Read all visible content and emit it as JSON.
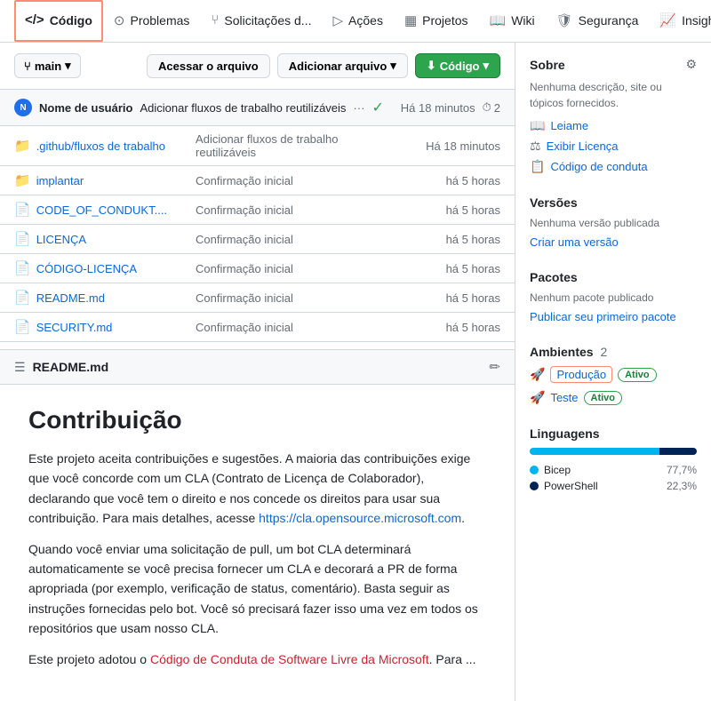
{
  "nav": {
    "tabs": [
      {
        "id": "code",
        "label": "Código",
        "icon": "</>",
        "active": true
      },
      {
        "id": "issues",
        "label": "Problemas",
        "icon": "⊙"
      },
      {
        "id": "prs",
        "label": "Solicitações d...",
        "icon": "⑂"
      },
      {
        "id": "actions",
        "label": "Ações",
        "icon": "▷"
      },
      {
        "id": "projects",
        "label": "Projetos",
        "icon": "▦"
      },
      {
        "id": "wiki",
        "label": "Wiki",
        "icon": "📖"
      },
      {
        "id": "security",
        "label": "Segurança",
        "icon": "🛡"
      },
      {
        "id": "insights",
        "label": "Insights",
        "icon": "📈"
      },
      {
        "id": "more",
        "label": "...",
        "icon": ""
      }
    ]
  },
  "branch_bar": {
    "branch_label": "main",
    "branch_icon": "⑂",
    "chevron": "▾",
    "access_file_btn": "Acessar o arquivo",
    "add_file_btn": "Adicionar arquivo",
    "add_file_chevron": "▾",
    "code_btn": "Código",
    "code_chevron": "▾"
  },
  "commit_row": {
    "username": "Nome de usuário",
    "message": "Adicionar fluxos de trabalho reutilizáveis",
    "dots": "···",
    "status_icon": "✓",
    "time": "Há 18 minutos",
    "clock_icon": "⏱",
    "count": "2"
  },
  "files": [
    {
      "icon": "📁",
      "name": ".github/fluxos de trabalho",
      "commit": "Adicionar fluxos de trabalho reutilizáveis",
      "time": "Há 18 minutos"
    },
    {
      "icon": "📁",
      "name": "implantar",
      "commit": "Confirmação inicial",
      "time": "há 5 horas"
    },
    {
      "icon": "📄",
      "name": "CODE_OF_CONDUKT....",
      "commit": "Confirmação inicial",
      "time": "há 5 horas"
    },
    {
      "icon": "📄",
      "name": "LICENÇA",
      "commit": "Confirmação inicial",
      "time": "há 5 horas"
    },
    {
      "icon": "📄",
      "name": "CÓDIGO-LICENÇA",
      "commit": "Confirmação inicial",
      "time": "há 5 horas"
    },
    {
      "icon": "📄",
      "name": "README.md",
      "commit": "Confirmação inicial",
      "time": "há 5 horas"
    },
    {
      "icon": "📄",
      "name": "SECURITY.md",
      "commit": "Confirmação inicial",
      "time": "há 5 horas"
    }
  ],
  "readme": {
    "title": "README.md",
    "edit_icon": "✏",
    "heading": "Contribuição",
    "p1": "Este projeto aceita contribuições e sugestões. A maioria das contribuições exige que você concorde com um CLA (Contrato de Licença de Colaborador), declarando que você tem o direito e nos concede os direitos para usar sua contribuição. Para mais detalhes, acesse ",
    "p1_link": "https://cla.opensource.microsoft.com",
    "p1_link_text": "https://cla.opensource.microsoft.com",
    "p2": "Quando você enviar uma solicitação de pull, um bot CLA determinará automaticamente se você precisa fornecer um CLA e decorará a PR de forma apropriada (por exemplo, verificação de status, comentário). Basta seguir as instruções fornecidas pelo bot. Você só precisará fazer isso uma vez em todos os repositórios que usam nosso CLA.",
    "p3_prefix": "Este projeto adotou o ",
    "p3_link_text": "Código de Conduta de Software Livre da Microsoft",
    "p3_suffix": ". Para ..."
  },
  "sidebar": {
    "sobre": {
      "title": "Sobre",
      "gear_icon": "⚙",
      "description": "Nenhuma descrição, site ou tópicos fornecidos.",
      "links": [
        {
          "icon": "📖",
          "text": "Leiame"
        },
        {
          "icon": "⚖",
          "text": "Exibir Licença"
        },
        {
          "icon": "📋",
          "text": "Código de conduta"
        }
      ]
    },
    "versoes": {
      "title": "Versões",
      "no_versions": "Nenhuma versão publicada",
      "create_link": "Criar uma versão"
    },
    "pacotes": {
      "title": "Pacotes",
      "no_packages": "Nenhum pacote publicado",
      "publish_link": "Publicar seu primeiro pacote"
    },
    "ambientes": {
      "title": "Ambientes",
      "count": "2",
      "items": [
        {
          "name": "Produção",
          "badge": "Ativo",
          "highlighted": true
        },
        {
          "name": "Teste",
          "badge": "Ativo",
          "highlighted": false
        }
      ]
    },
    "linguagens": {
      "title": "Linguagens",
      "items": [
        {
          "name": "Bicep",
          "pct": "77,7%",
          "color": "#00b4f0",
          "width": 77.7
        },
        {
          "name": "PowerShell",
          "pct": "22,3%",
          "color": "#012456",
          "width": 22.3
        }
      ]
    }
  }
}
